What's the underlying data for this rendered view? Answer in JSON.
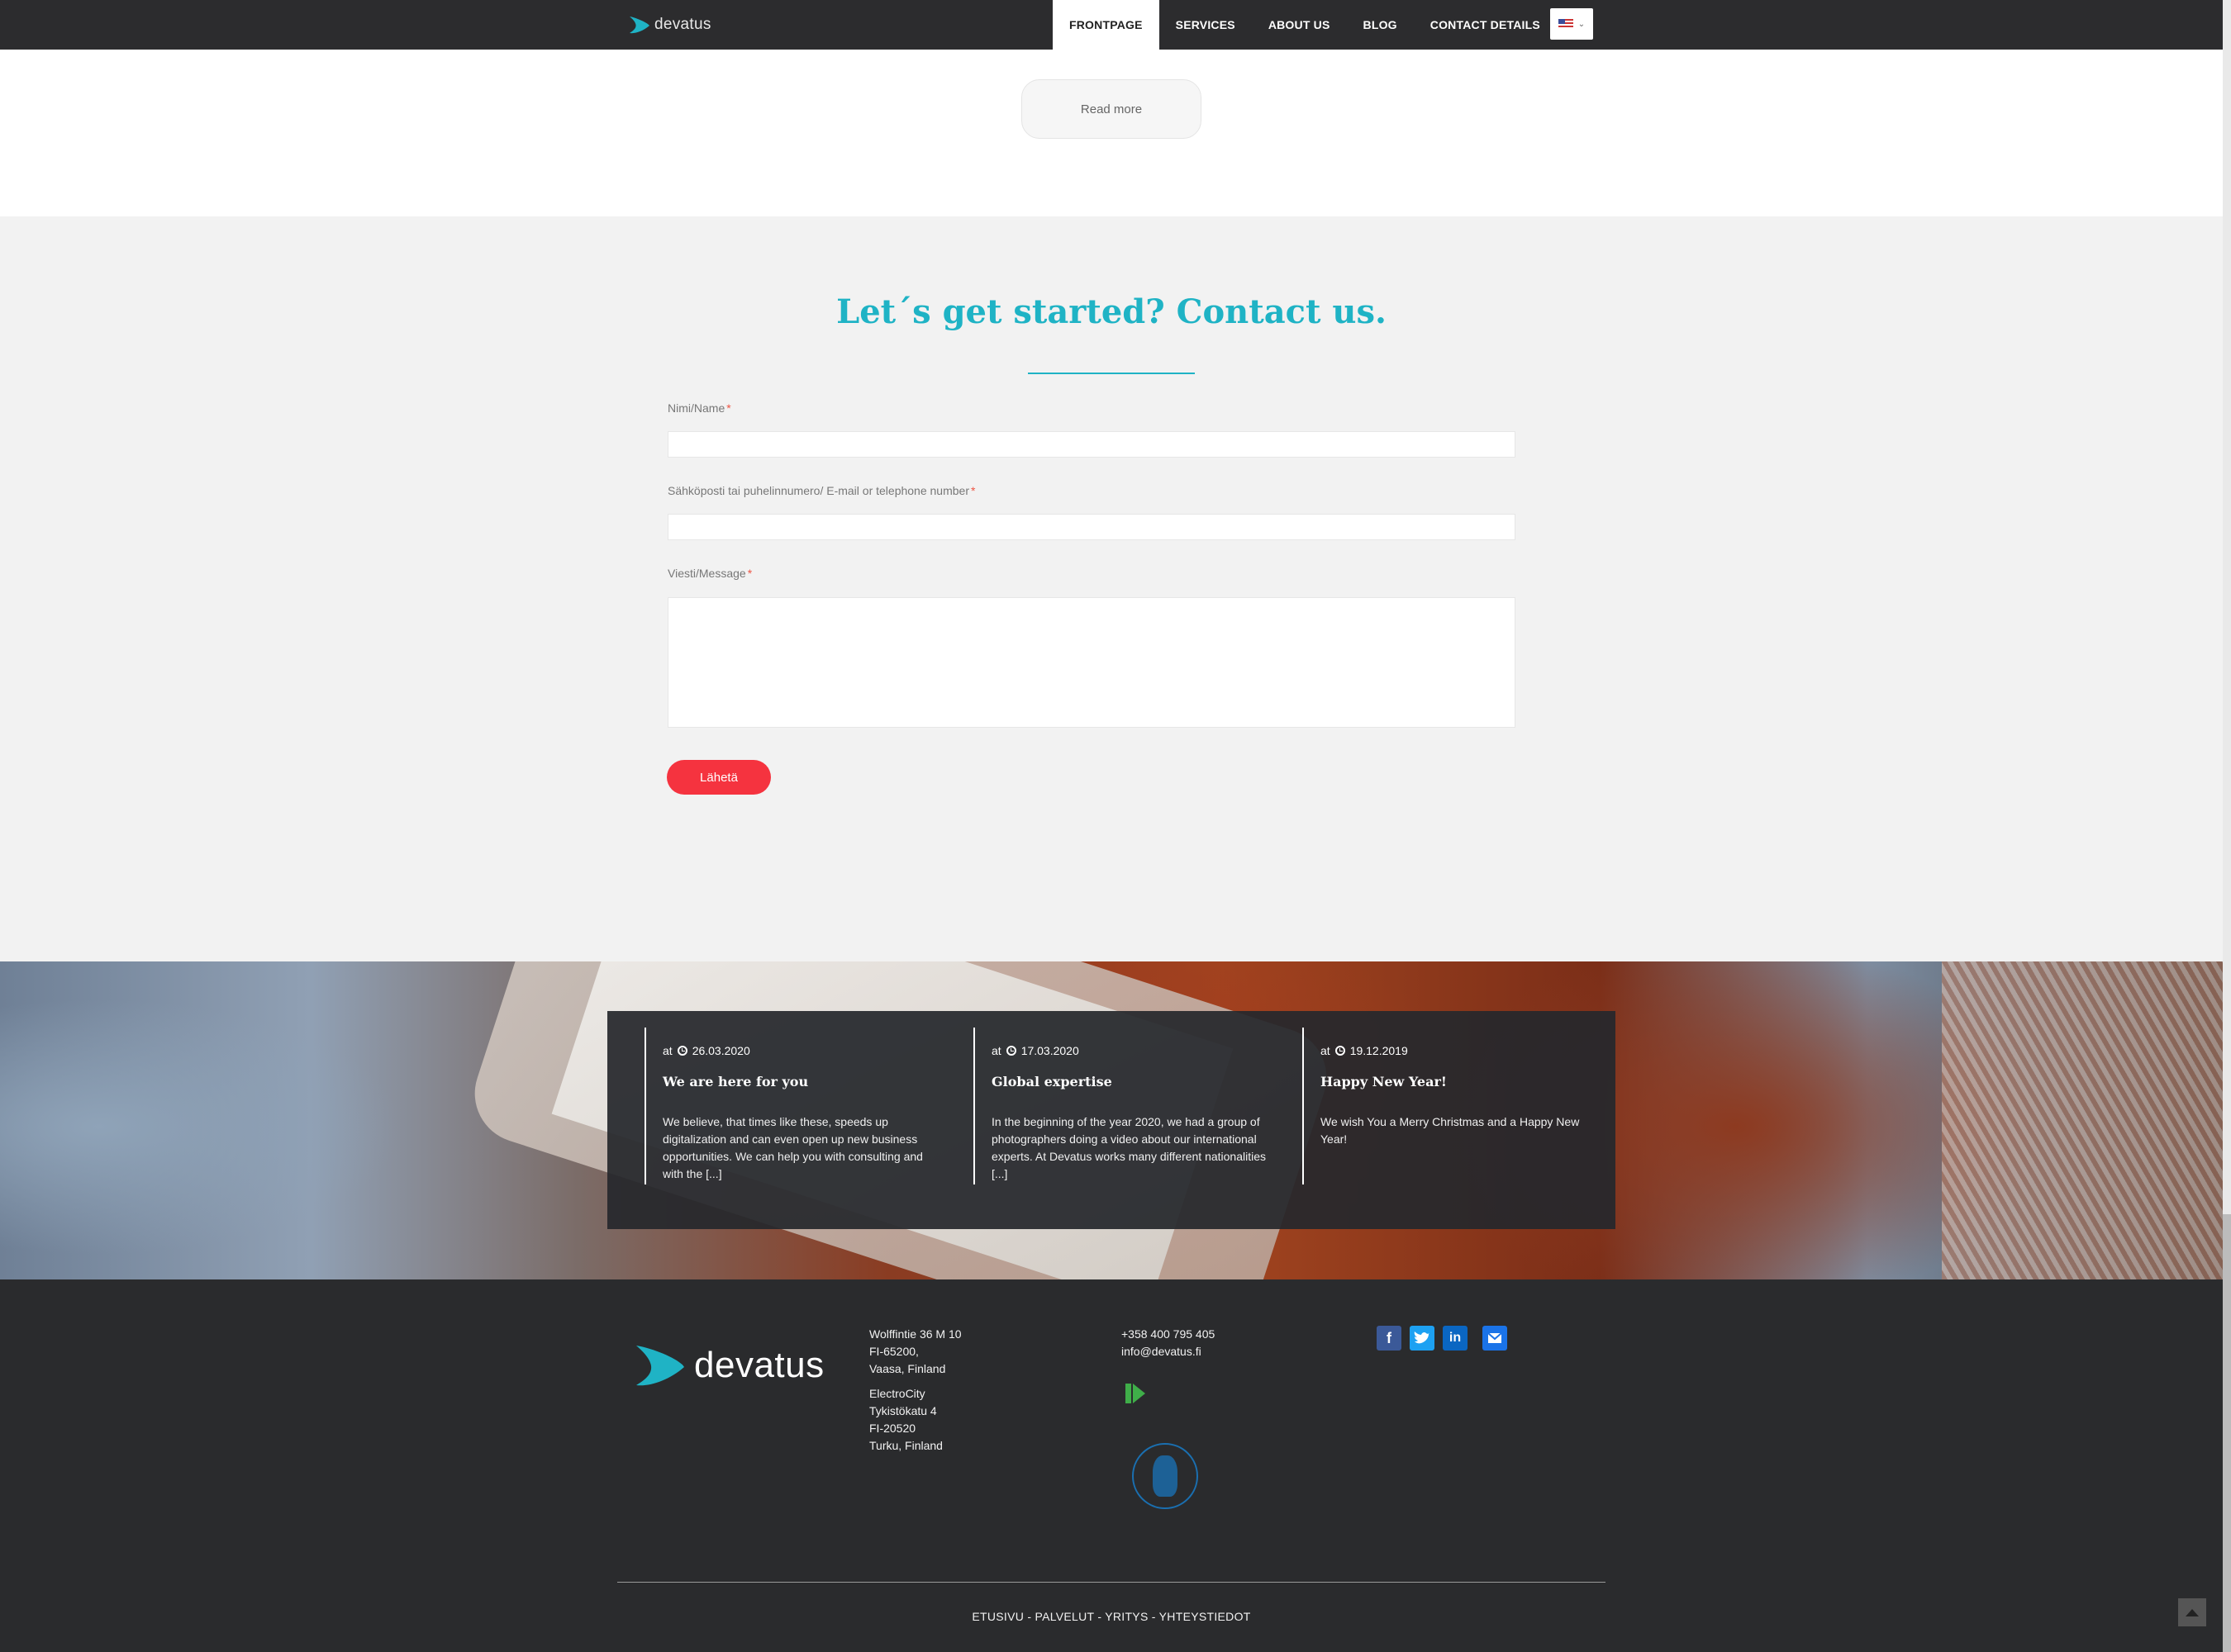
{
  "header": {
    "logo_text": "devatus",
    "nav": [
      "FRONTPAGE",
      "SERVICES",
      "ABOUT US",
      "BLOG",
      "CONTACT DETAILS"
    ],
    "active_nav": "FRONTPAGE",
    "language": "en-US flag"
  },
  "top": {
    "read_more": "Read more"
  },
  "contact": {
    "title": "Let´s get started? Contact us.",
    "fields": {
      "name_label": "Nimi/Name",
      "contact_label": "Sähköposti tai puhelinnumero/ E-mail or telephone number",
      "message_label": "Viesti/Message",
      "required_marker": "*"
    },
    "submit_label": "Lähetä"
  },
  "posts": [
    {
      "prefix": "at",
      "date": "26.03.2020",
      "title": "We are here for you",
      "excerpt": "We believe, that times like these, speeds up digitalization and can even open up new business opportunities. We can help you with consulting and with the [...]"
    },
    {
      "prefix": "at",
      "date": "17.03.2020",
      "title": "Global expertise",
      "excerpt": "In the beginning of the year 2020, we had a group of photographers doing a video about our international experts. At Devatus works many different nationalities [...]"
    },
    {
      "prefix": "at",
      "date": "19.12.2019",
      "title": "Happy New Year!",
      "excerpt": "We wish You a Merry Christmas and a Happy New Year!"
    }
  ],
  "footer": {
    "logo_text": "devatus",
    "address_vaasa": "Wolffintie 36 M 10\nFI-65200,\nVaasa, Finland",
    "address_turku": "ElectroCity\nTykistökatu 4\nFI-20520\nTurku, Finland",
    "phone": "+358 400 795 405",
    "email": "info@devatus.fi",
    "social_icons": [
      "facebook-icon",
      "twitter-icon",
      "linkedin-icon",
      "email-icon"
    ],
    "links": "ETUSIVU - PALVELUT - YRITYS - YHTEYSTIEDOT"
  },
  "colors": {
    "accent": "#1fb3c5",
    "submit": "#f5333f",
    "header_bg": "#2c2c2e",
    "footer_bg": "#2a2b2d",
    "section_bg": "#f2f2f2"
  }
}
